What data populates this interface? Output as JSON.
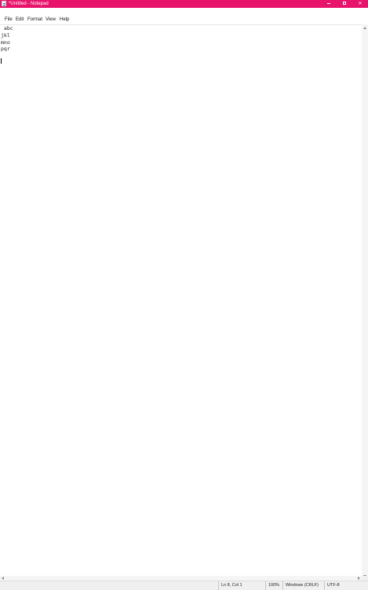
{
  "window": {
    "title": "*Untitled - Notepad",
    "accent_color": "#e8146c",
    "app_icon": "notepad-icon"
  },
  "controls": {
    "minimize_icon": "minimize-icon",
    "maximize_icon": "maximize-icon",
    "close_glyph": "✕"
  },
  "menu": {
    "items": [
      "File",
      "Edit",
      "Format",
      "View",
      "Help"
    ]
  },
  "editor": {
    "lines": [
      " abc",
      "jkl",
      "mno",
      "pqr",
      ""
    ]
  },
  "status": {
    "position": "Ln 8, Col 1",
    "zoom": "100%",
    "line_ending": "Windows (CRLF)",
    "encoding": "UTF-8"
  }
}
